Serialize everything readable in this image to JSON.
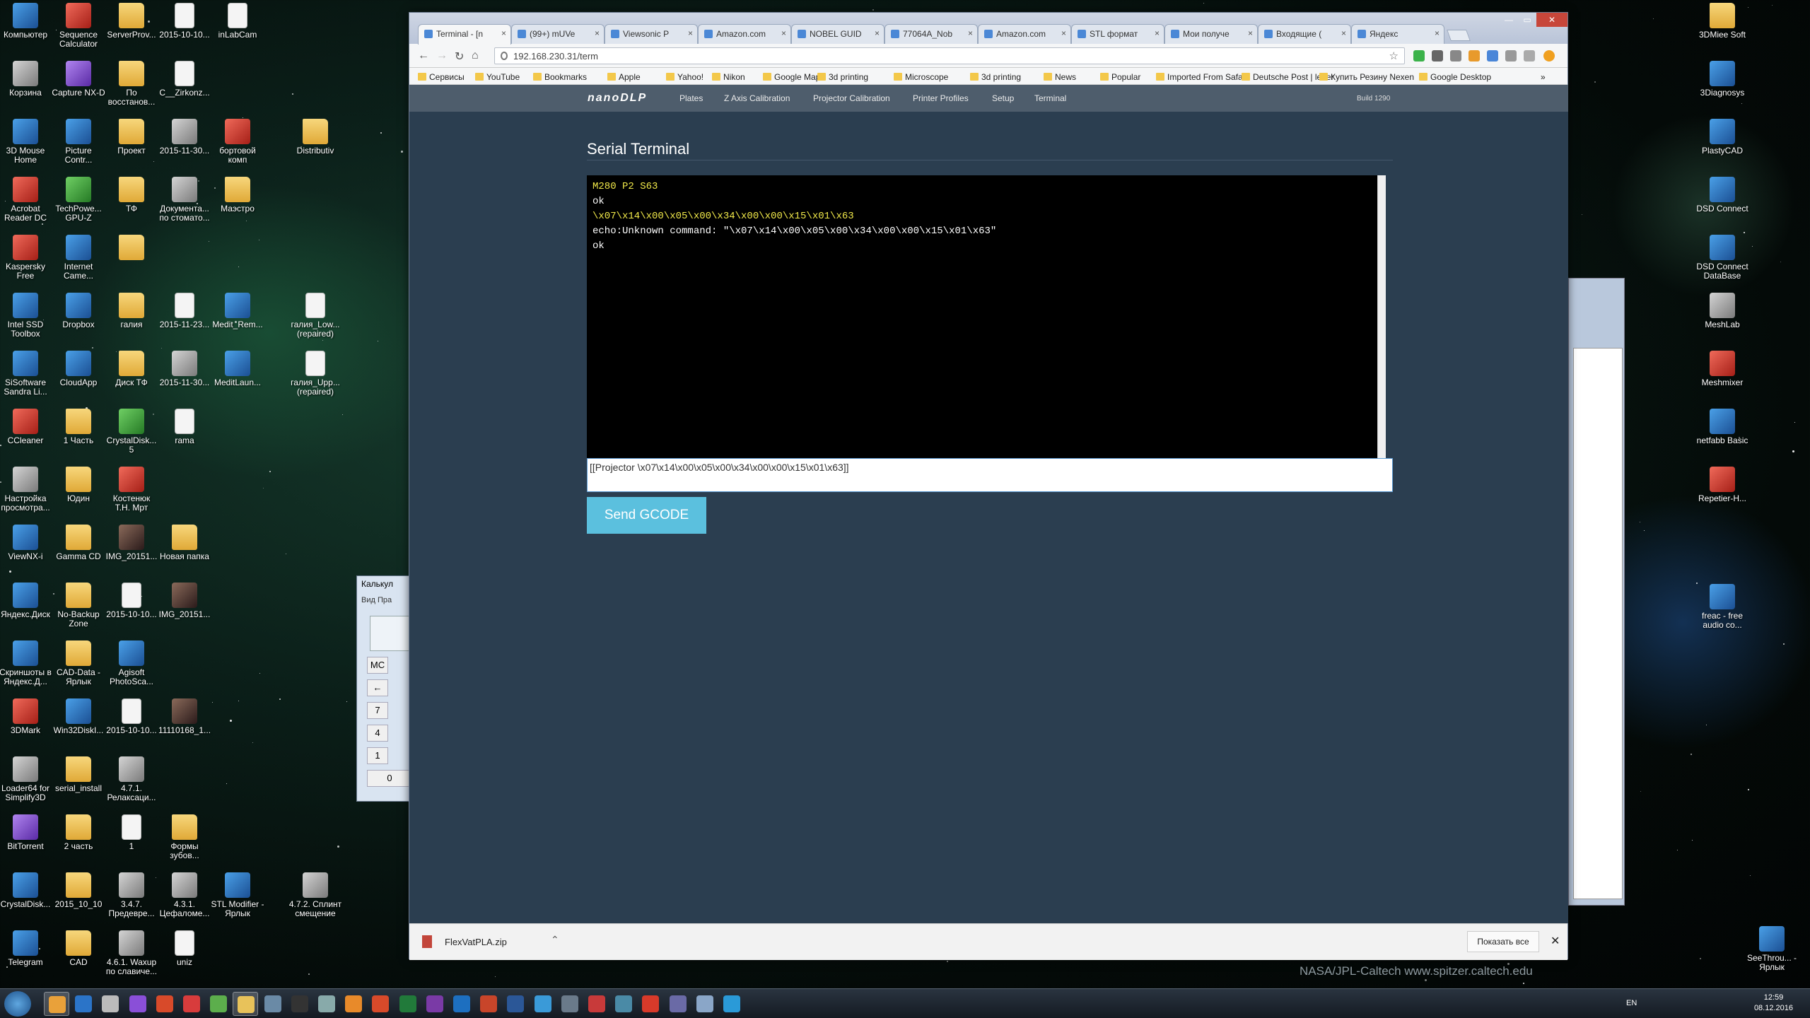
{
  "desktop": {
    "credit": "NASA/JPL-Caltech    www.spitzer.caltech.edu",
    "icons_left": [
      {
        "label": "Компьютер",
        "kind": "app"
      },
      {
        "label": "Sequence Calculator",
        "kind": "red"
      },
      {
        "label": "ServerProv...",
        "kind": "folder"
      },
      {
        "label": "2015-10-10...",
        "kind": "file"
      },
      {
        "label": "inLabCam",
        "kind": "file"
      },
      {
        "label": "Корзина",
        "kind": "gray"
      },
      {
        "label": "Capture NX-D",
        "kind": "purple"
      },
      {
        "label": "По восстанов...",
        "kind": "folder"
      },
      {
        "label": "C__Zirkonz...",
        "kind": "file"
      },
      {
        "label": "3D Mouse Home",
        "kind": "app"
      },
      {
        "label": "Picture Contr...",
        "kind": "app"
      },
      {
        "label": "Проект",
        "kind": "folder"
      },
      {
        "label": "2015-11-30...",
        "kind": "gray"
      },
      {
        "label": "бортовой комп",
        "kind": "red"
      },
      {
        "label": "Distributiv",
        "kind": "folder"
      },
      {
        "label": "Acrobat Reader DC",
        "kind": "red"
      },
      {
        "label": "TechPowe... GPU-Z",
        "kind": "green"
      },
      {
        "label": "ТФ",
        "kind": "folder"
      },
      {
        "label": "Документа... по стомато...",
        "kind": "gray"
      },
      {
        "label": "Маэстро",
        "kind": "folder"
      },
      {
        "label": "Kaspersky Free",
        "kind": "red"
      },
      {
        "label": "Internet Came...",
        "kind": "app"
      },
      {
        "label": "",
        "kind": "folder"
      },
      {
        "label": "Intel SSD Toolbox",
        "kind": "app"
      },
      {
        "label": "Dropbox",
        "kind": "app"
      },
      {
        "label": "галия",
        "kind": "folder"
      },
      {
        "label": "2015-11-23...",
        "kind": "file"
      },
      {
        "label": "Medit_Rem...",
        "kind": "app"
      },
      {
        "label": "галия_Low... (repaired)",
        "kind": "file"
      },
      {
        "label": "SiSoftware Sandra Li...",
        "kind": "app"
      },
      {
        "label": "CloudApp",
        "kind": "app"
      },
      {
        "label": "Диск ТФ",
        "kind": "folder"
      },
      {
        "label": "2015-11-30...",
        "kind": "gray"
      },
      {
        "label": "MeditLaun...",
        "kind": "app"
      },
      {
        "label": "галия_Upp... (repaired)",
        "kind": "file"
      },
      {
        "label": "CCleaner",
        "kind": "red"
      },
      {
        "label": "1 Часть",
        "kind": "folder"
      },
      {
        "label": "CrystalDisk... 5",
        "kind": "green"
      },
      {
        "label": "rama",
        "kind": "file"
      },
      {
        "label": "Настройка просмотра...",
        "kind": "gray"
      },
      {
        "label": "Юдин",
        "kind": "folder"
      },
      {
        "label": "Костенюк Т.Н. Мрт",
        "kind": "red"
      },
      {
        "label": "ViewNX-i",
        "kind": "app"
      },
      {
        "label": "Gamma CD",
        "kind": "folder"
      },
      {
        "label": "IMG_20151...",
        "kind": "img"
      },
      {
        "label": "Новая папка",
        "kind": "folder"
      },
      {
        "label": "Яндекс.Диск",
        "kind": "app"
      },
      {
        "label": "No-Backup Zone",
        "kind": "folder"
      },
      {
        "label": "2015-10-10...",
        "kind": "file"
      },
      {
        "label": "IMG_20151...",
        "kind": "img"
      },
      {
        "label": "Скриншоты в Яндекс.Д...",
        "kind": "app"
      },
      {
        "label": "CAD-Data - Ярлык",
        "kind": "folder"
      },
      {
        "label": "Agisoft PhotoSca...",
        "kind": "app"
      },
      {
        "label": "3DMark",
        "kind": "red"
      },
      {
        "label": "Win32DiskI...",
        "kind": "app"
      },
      {
        "label": "2015-10-10...",
        "kind": "file"
      },
      {
        "label": "11110168_1...",
        "kind": "img"
      },
      {
        "label": "Loader64 for Simplify3D",
        "kind": "gray"
      },
      {
        "label": "serial_install",
        "kind": "folder"
      },
      {
        "label": "4.7.1. Релаксаци...",
        "kind": "gray"
      },
      {
        "label": "BitTorrent",
        "kind": "purple"
      },
      {
        "label": "2 часть",
        "kind": "folder"
      },
      {
        "label": "1",
        "kind": "file"
      },
      {
        "label": "Формы зубов...",
        "kind": "folder"
      },
      {
        "label": "CrystalDisk...",
        "kind": "app"
      },
      {
        "label": "2015_10_10",
        "kind": "folder"
      },
      {
        "label": "3.4.7. Предевре...",
        "kind": "gray"
      },
      {
        "label": "4.3.1. Цефаломе...",
        "kind": "gray"
      },
      {
        "label": "STL Modifier - Ярлык",
        "kind": "app"
      },
      {
        "label": "4.7.2. Сплинт смещение",
        "kind": "gray"
      },
      {
        "label": "Telegram",
        "kind": "app"
      },
      {
        "label": "CAD",
        "kind": "folder"
      },
      {
        "label": "4.6.1. Waxup по славиче...",
        "kind": "gray"
      },
      {
        "label": "uniz",
        "kind": "file"
      }
    ],
    "icons_right": [
      {
        "label": "3DMiee Soft",
        "kind": "folder"
      },
      {
        "label": "3Diagnosys",
        "kind": "app"
      },
      {
        "label": "PlastyCAD",
        "kind": "app"
      },
      {
        "label": "DSD Connect",
        "kind": "app"
      },
      {
        "label": "DSD Connect DataBase",
        "kind": "app"
      },
      {
        "label": "MeshLab",
        "kind": "gray"
      },
      {
        "label": "Meshmixer",
        "kind": "red"
      },
      {
        "label": "netfabb Basic",
        "kind": "app"
      },
      {
        "label": "Repetier-H...",
        "kind": "red"
      },
      {
        "label": "freac - free audio co...",
        "kind": "app"
      },
      {
        "label": "SeeThrou... - Ярлык",
        "kind": "app"
      }
    ]
  },
  "calculator": {
    "title": "Калькул",
    "menu": "Вид  Пра",
    "keys": [
      "MC",
      "←",
      "7",
      "4",
      "1",
      "0"
    ]
  },
  "browser": {
    "tabs": [
      "Terminal - [n",
      "(99+) mUVe",
      "Viewsonic P",
      "Amazon.com",
      "NOBEL GUID",
      "77064A_Nob",
      "Amazon.com",
      "STL формат",
      "Мои получе",
      "Входящие (",
      "Яндекс"
    ],
    "url": "192.168.230.31/term",
    "bookmarks": [
      "Сервисы",
      "YouTube",
      "Bookmarks",
      "Apple",
      "Yahoo!",
      "Nikon",
      "Google Maps",
      "3d printing",
      "Microscope",
      "3d printing",
      "News",
      "Popular",
      "Imported From Safari",
      "Deutsche Post | letter",
      "Купить Резину Nexen",
      "Google Desktop"
    ]
  },
  "app": {
    "brand": "nanoDLP",
    "nav": [
      "Plates",
      "Z Axis Calibration",
      "Projector Calibration",
      "Printer Profiles",
      "Setup",
      "Terminal"
    ],
    "build": "Build 1290",
    "title": "Serial Terminal",
    "terminal_lines": [
      {
        "text": "M280 P2 S63",
        "color": "#f1e94a"
      },
      {
        "text": "ok",
        "color": "#ffffff"
      },
      {
        "text": "\\x07\\x14\\x00\\x05\\x00\\x34\\x00\\x00\\x15\\x01\\x63",
        "color": "#f1e94a"
      },
      {
        "text": "echo:Unknown command: \"\\x07\\x14\\x00\\x05\\x00\\x34\\x00\\x00\\x15\\x01\\x63\"",
        "color": "#ffffff"
      },
      {
        "text": "ok",
        "color": "#ffffff"
      }
    ],
    "gcode_input": "[[Projector  \\x07\\x14\\x00\\x05\\x00\\x34\\x00\\x00\\x15\\x01\\x63]]",
    "send_label": "Send GCODE"
  },
  "downloads": {
    "file": "FlexVatPLA.zip",
    "show_all": "Показать все"
  },
  "taskbar": {
    "lang": "EN",
    "time": "12:59",
    "date": "08.12.2016",
    "apps": [
      "chrome",
      "ie",
      "itunes",
      "c-app",
      "revo",
      "redapp",
      "green",
      "explorer",
      "notepad",
      "exo",
      "monitor",
      "firefox",
      "ring",
      "excel",
      "onenote",
      "outlook",
      "powerpoint",
      "word",
      "sound",
      "gear",
      "redwin",
      "fish",
      "yandex",
      "cura",
      "docs",
      "telegram"
    ]
  }
}
